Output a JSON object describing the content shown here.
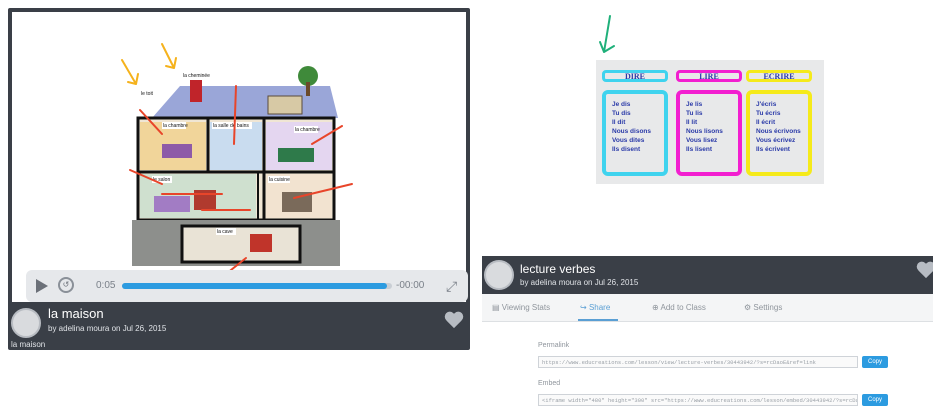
{
  "left_card": {
    "house_labels": [
      "le toit",
      "la cheminée",
      "la chambre",
      "la salle de bains",
      "la chambre",
      "la cuisine",
      "le salon",
      "la cave"
    ],
    "player": {
      "current_time": "0:05",
      "end_time": "-00:00",
      "progress": 0.98
    },
    "title": "la maison",
    "byline": "by adelina moura on Jul 26, 2015",
    "caption": "la maison"
  },
  "conjugation": {
    "columns": [
      {
        "head": "DIRE",
        "color": "#3fd3ee",
        "verbs": [
          "Je dis",
          "Tu dis",
          "Il dit",
          "Nous disons",
          "Vous dites",
          "Ils disent"
        ]
      },
      {
        "head": "LIRE",
        "color": "#f21fd0",
        "verbs": [
          "Je lis",
          "Tu lis",
          "Il lit",
          "Nous lisons",
          "Vous lisez",
          "Ils lisent"
        ]
      },
      {
        "head": "ECRIRE",
        "color": "#f5ea1a",
        "verbs": [
          "J'écris",
          "Tu écris",
          "Il écrit",
          "Nous écrivons",
          "Vous écrivez",
          "Ils écrivent"
        ]
      }
    ]
  },
  "right_card": {
    "title": "lecture verbes",
    "byline": "by adelina moura on Jul 26, 2015",
    "tabs": [
      "Viewing Stats",
      "Share",
      "Add to Class",
      "Settings"
    ],
    "permalink_label": "Permalink",
    "permalink_value": "https://www.educreations.com/lesson/view/lecture-verbes/30443942/?s=rcDaoE&ref=link",
    "embed_label": "Embed",
    "embed_value": "<iframe width=\"480\" height=\"300\" src=\"https://www.educreations.com/lesson/embed/30443942/?s=rcDaoE&ref=embed\"",
    "copy_label": "Copy"
  },
  "colors": {
    "accent": "#2c9be0",
    "dark": "#3a3f47"
  }
}
